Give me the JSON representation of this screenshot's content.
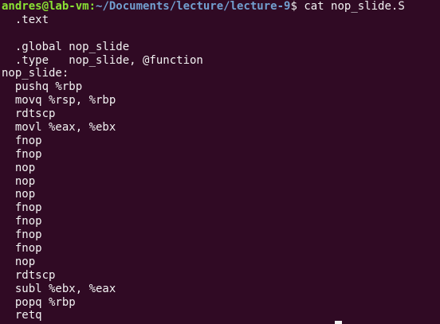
{
  "prompt": {
    "user_host": "andres@lab-vm",
    "separator": ":",
    "path": "~/Documents/lecture/lecture-9",
    "symbol": "$",
    "command": " cat nop_slide.S"
  },
  "file_lines": [
    "  .text",
    "",
    "  .global nop_slide",
    "  .type   nop_slide, @function",
    "nop_slide:",
    "  pushq %rbp",
    "  movq %rsp, %rbp",
    "  rdtscp",
    "  movl %eax, %ebx",
    "  fnop",
    "  fnop",
    "  nop",
    "  nop",
    "  nop",
    "  fnop",
    "  fnop",
    "  fnop",
    "  fnop",
    "  nop",
    "  rdtscp",
    "  subl %ebx, %eax",
    "  popq %rbp",
    "  retq"
  ]
}
